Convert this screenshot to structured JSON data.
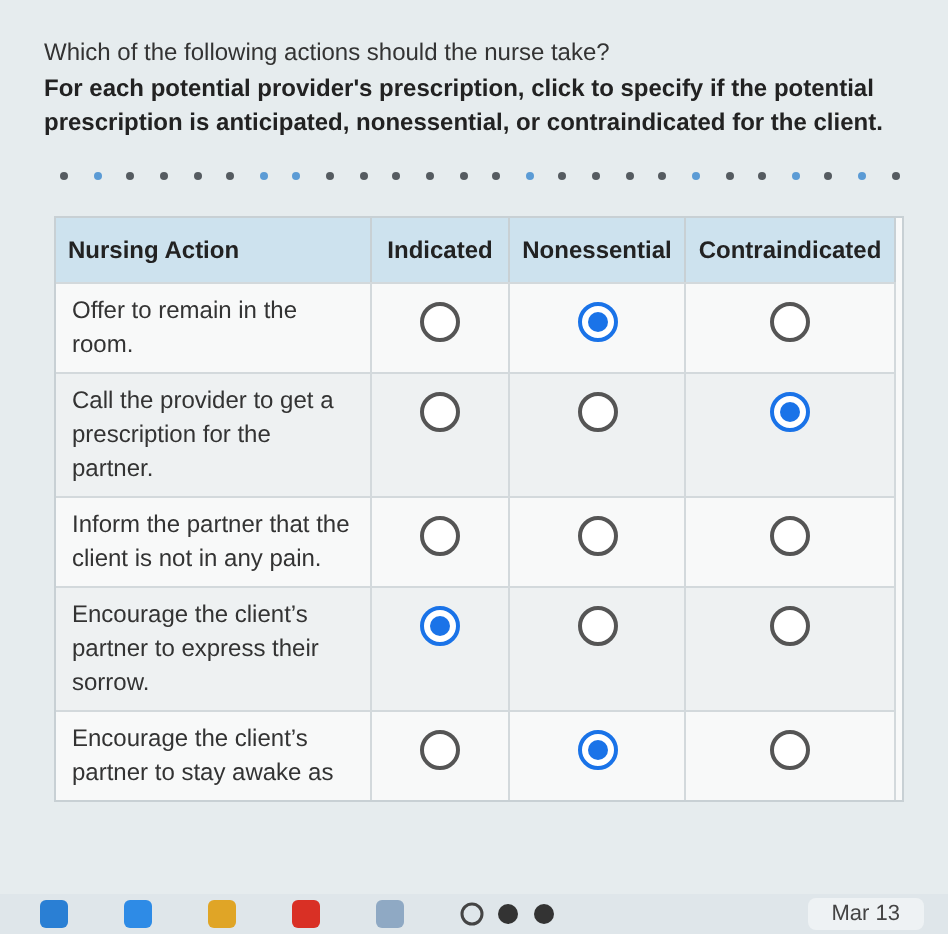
{
  "question": "Which of the following actions should the nurse take?",
  "instructions": "For each potential provider's prescription, click to specify if the potential prescription is anticipated, nonessential, or contraindicated for the client.",
  "progress_dots": [
    {
      "color": "#555b60"
    },
    {
      "color": "#5b9bd5"
    },
    {
      "color": "#555b60"
    },
    {
      "color": "#555b60"
    },
    {
      "color": "#555b60"
    },
    {
      "color": "#555b60"
    },
    {
      "color": "#5b9bd5"
    },
    {
      "color": "#5b9bd5"
    },
    {
      "color": "#555b60"
    },
    {
      "color": "#555b60"
    },
    {
      "color": "#555b60"
    },
    {
      "color": "#555b60"
    },
    {
      "color": "#555b60"
    },
    {
      "color": "#555b60"
    },
    {
      "color": "#5b9bd5"
    },
    {
      "color": "#555b60"
    },
    {
      "color": "#555b60"
    },
    {
      "color": "#555b60"
    },
    {
      "color": "#555b60"
    },
    {
      "color": "#5b9bd5"
    },
    {
      "color": "#555b60"
    },
    {
      "color": "#555b60"
    },
    {
      "color": "#5b9bd5"
    },
    {
      "color": "#555b60"
    },
    {
      "color": "#5b9bd5"
    },
    {
      "color": "#555b60"
    }
  ],
  "table": {
    "columns": [
      "Nursing Action",
      "Indicated",
      "Nonessential",
      "Contraindicated"
    ],
    "rows": [
      {
        "action": "Offer to remain in the room.",
        "options": [
          {
            "selected": false
          },
          {
            "selected": true
          },
          {
            "selected": false
          }
        ]
      },
      {
        "action": "Call the provider to get a prescription for the partner.",
        "options": [
          {
            "selected": false
          },
          {
            "selected": false
          },
          {
            "selected": true
          }
        ]
      },
      {
        "action": "Inform the partner that the client is not in any pain.",
        "options": [
          {
            "selected": false
          },
          {
            "selected": false
          },
          {
            "selected": false
          }
        ]
      },
      {
        "action": "Encourage the client’s partner to express their sorrow.",
        "options": [
          {
            "selected": true
          },
          {
            "selected": false
          },
          {
            "selected": false
          }
        ]
      },
      {
        "action": "Encourage the client’s partner to stay awake as",
        "options": [
          {
            "selected": false
          },
          {
            "selected": true
          },
          {
            "selected": false
          }
        ]
      }
    ]
  },
  "taskbar": {
    "date": "Mar 13"
  }
}
